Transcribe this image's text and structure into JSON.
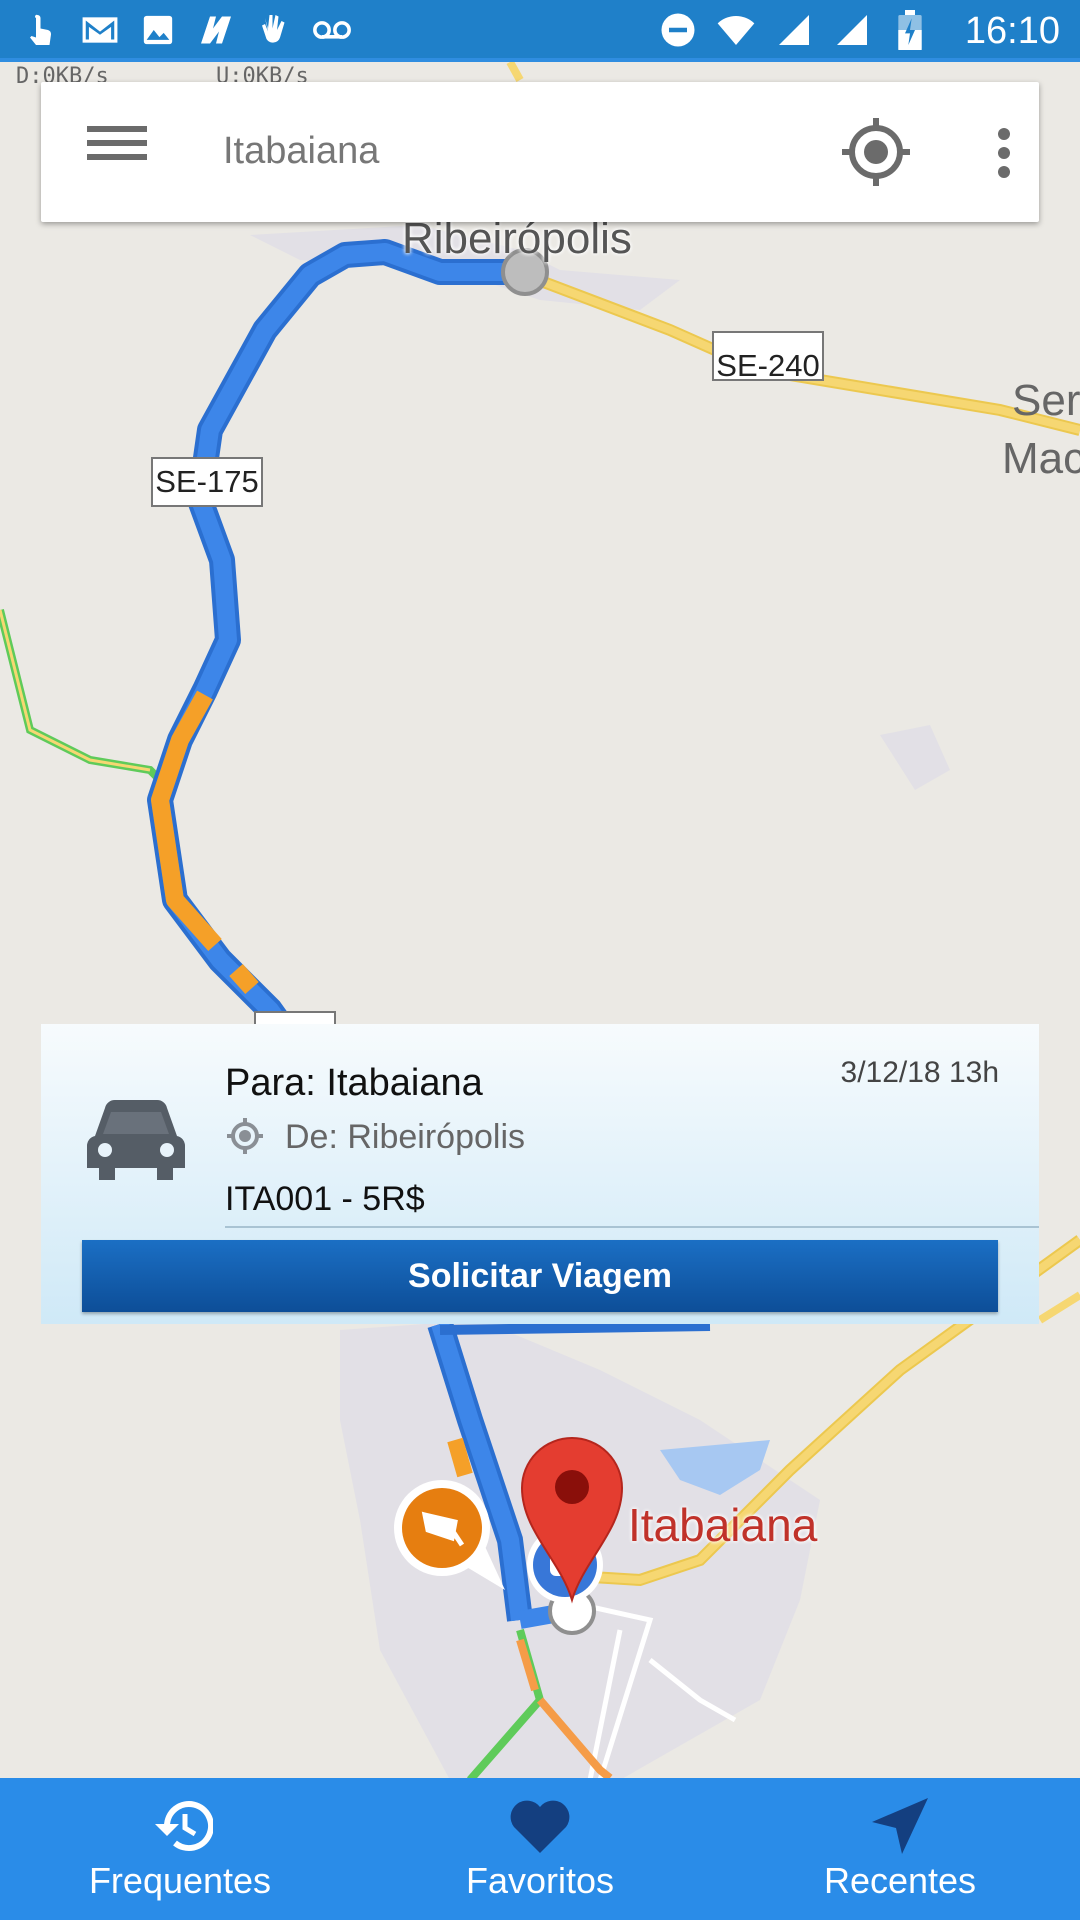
{
  "status_bar": {
    "time": "16:10",
    "icons_left": [
      "touch-icon",
      "gmail-icon",
      "image-icon",
      "n-app-icon",
      "hand-icon",
      "voicemail-icon"
    ],
    "icons_right": [
      "do-not-disturb-icon",
      "wifi-icon",
      "signal-icon",
      "signal-icon",
      "battery-icon"
    ],
    "download_speed": "D:0KB/s",
    "upload_speed": "U:0KB/s"
  },
  "search": {
    "value": "Itabaiana"
  },
  "map": {
    "labels": {
      "ribeiropolis": "Ribeirópolis",
      "se240": "SE-240",
      "se175": "SE-175",
      "itabaiana": "Itabaiana",
      "ser": "Ser",
      "mac": "Mac"
    },
    "colors": {
      "route": "#3d86e9",
      "traffic_slow": "#f5a028",
      "highway": "#f6d772",
      "traffic_fast": "#5fcb5a",
      "pin": "#e43d30",
      "camera": "#e67e10"
    }
  },
  "trip": {
    "to": "Para: Itabaiana",
    "date": "3/12/18 13h",
    "from": "De: Ribeirópolis",
    "code": "ITA001 - 5R$",
    "button": "Solicitar Viagem"
  },
  "bottom_nav": {
    "items": [
      {
        "label": "Frequentes",
        "icon": "history-icon"
      },
      {
        "label": "Favoritos",
        "icon": "heart-icon"
      },
      {
        "label": "Recentes",
        "icon": "navigation-arrow-icon"
      }
    ],
    "color": "#2a8ce8"
  }
}
